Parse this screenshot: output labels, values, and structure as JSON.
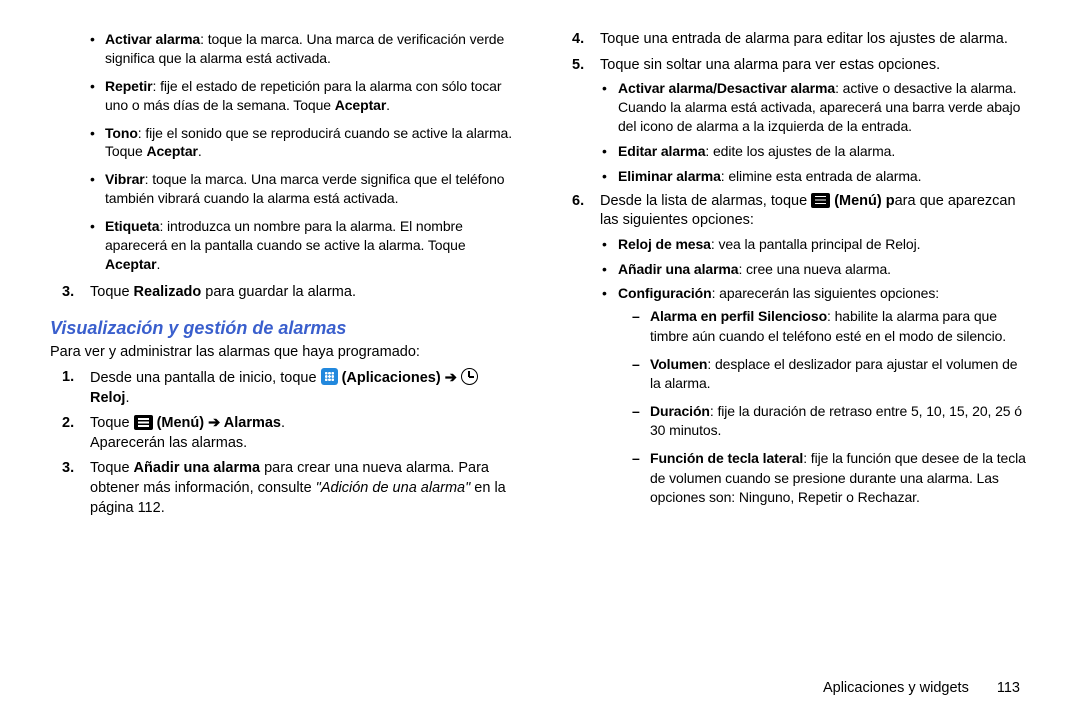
{
  "left": {
    "bullets": [
      {
        "label": "Activar alarma",
        "text": ": toque la marca. Una marca de verificación verde significa que la alarma está activada."
      },
      {
        "label": "Repetir",
        "text": ": fije el estado de repetición para la alarma con sólo tocar uno o más días de la semana. Toque ",
        "tail_bold": "Aceptar",
        "tail": "."
      },
      {
        "label": "Tono",
        "text": ": fije el sonido que se reproducirá cuando se active la alarma. Toque ",
        "tail_bold": "Aceptar",
        "tail": "."
      },
      {
        "label": "Vibrar",
        "text": ": toque la marca. Una marca verde significa que el teléfono también vibrará cuando la alarma está activada."
      },
      {
        "label": "Etiqueta",
        "text": ": introduzca un nombre para la alarma. El nombre aparecerá en la pantalla cuando se active la alarma. Toque ",
        "tail_bold": "Aceptar",
        "tail": "."
      }
    ],
    "step3_pre": "Toque ",
    "step3_bold": "Realizado",
    "step3_post": " para guardar la alarma.",
    "heading": "Visualización y gestión de alarmas",
    "intro": "Para ver y administrar las alarmas que haya programado:",
    "v1_pre": "Desde una pantalla de inicio, toque ",
    "v1_apps": "(Aplicaciones)",
    "v1_arrow": " ➔ ",
    "v1_reloj": "Reloj",
    "v2_pre": "Toque ",
    "v2_menu": "(Menú)",
    "v2_arrow": " ➔ ",
    "v2_alarmas": "Alarmas",
    "v2_line2": "Aparecerán las alarmas.",
    "v3_pre": "Toque ",
    "v3_bold": "Añadir una alarma",
    "v3_post": " para crear una nueva alarma. Para obtener más información, consulte ",
    "v3_italic": "\"Adición de una alarma\"",
    "v3_tail": " en la página 112."
  },
  "right": {
    "step4": "Toque una entrada de alarma para editar los ajustes de alarma.",
    "step5": "Toque sin soltar una alarma para ver estas opciones.",
    "s5_bullets": [
      {
        "label": "Activar alarma/Desactivar alarma",
        "text": ": active o desactive la alarma. Cuando la alarma está activada, aparecerá una barra verde abajo del icono de alarma a la izquierda de la entrada."
      },
      {
        "label": "Editar alarma",
        "text": ": edite los ajustes de la alarma."
      },
      {
        "label": "Eliminar alarma",
        "text": ": elimine esta entrada de alarma."
      }
    ],
    "s6_pre": "Desde la lista de alarmas, toque ",
    "s6_menu": "(Menú) p",
    "s6_post": "ara que aparezcan las siguientes opciones:",
    "s6_bullets_simple": [
      {
        "label": "Reloj de mesa",
        "text": ": vea la pantalla principal de Reloj."
      },
      {
        "label": "Añadir una alarma",
        "text": ": cree una nueva alarma."
      }
    ],
    "s6_config_label": "Configuración",
    "s6_config_text": ": aparecerán las siguientes opciones:",
    "dashes": [
      {
        "label": "Alarma en perfil Silencioso",
        "text": ": habilite la alarma para que timbre aún cuando el teléfono esté en el modo de silencio."
      },
      {
        "label": "Volumen",
        "text": ": desplace el deslizador para ajustar el volumen de la alarma."
      },
      {
        "label": "Duración",
        "text": ": fije la duración de retraso entre 5, 10, 15, 20, 25 ó 30 minutos."
      },
      {
        "label": "Función de tecla lateral",
        "text": ": fije la función que desee de la tecla de volumen cuando se presione durante una alarma. Las opciones son: Ninguno, Repetir o Rechazar."
      }
    ]
  },
  "footer": {
    "section": "Aplicaciones y widgets",
    "page": "113"
  }
}
